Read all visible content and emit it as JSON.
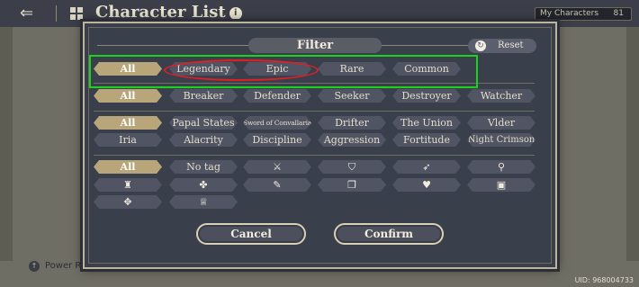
{
  "background": {
    "title": "Character List",
    "title_info_icon": "i",
    "back_icon": "back-arrow-icon",
    "grid_icon": "grid-icon",
    "my_characters_label": "My Characters",
    "my_characters_count": "81",
    "power_label": "Power R",
    "uid": "UID: 968004733"
  },
  "filter": {
    "title": "Filter",
    "reset_label": "Reset",
    "rarity_row": [
      "All",
      "Legendary",
      "Epic",
      "Rare",
      "Common"
    ],
    "class_row": [
      "All",
      "Breaker",
      "Defender",
      "Seeker",
      "Destroyer",
      "Watcher"
    ],
    "faction_row_1": [
      "All",
      "Papal States",
      "Sword of Convallaria",
      "Drifter",
      "The Union",
      "Vlder"
    ],
    "faction_row_2": [
      "Iria",
      "Alacrity",
      "Discipline",
      "Aggression",
      "Fortitude",
      "Night Crimson"
    ],
    "tag_row_1": [
      "All",
      "No tag",
      "sword-icon",
      "shield-icon",
      "bow-icon",
      "staff-icon"
    ],
    "tag_row_2": [
      "chess-rook-icon",
      "paw-icon",
      "feather-icon",
      "book-icon",
      "heart-icon",
      "chest-icon"
    ],
    "tag_row_3": [
      "clover-icon",
      "trophy-icon"
    ],
    "cancel_label": "Cancel",
    "confirm_label": "Confirm"
  },
  "annotations": {
    "green_box_color": "#19d31c",
    "red_ellipse_color": "#e21f25"
  },
  "colors": {
    "selected_chip": "#b9a57a",
    "chip": "#515462",
    "modal_bg": "#3a3f4c"
  }
}
